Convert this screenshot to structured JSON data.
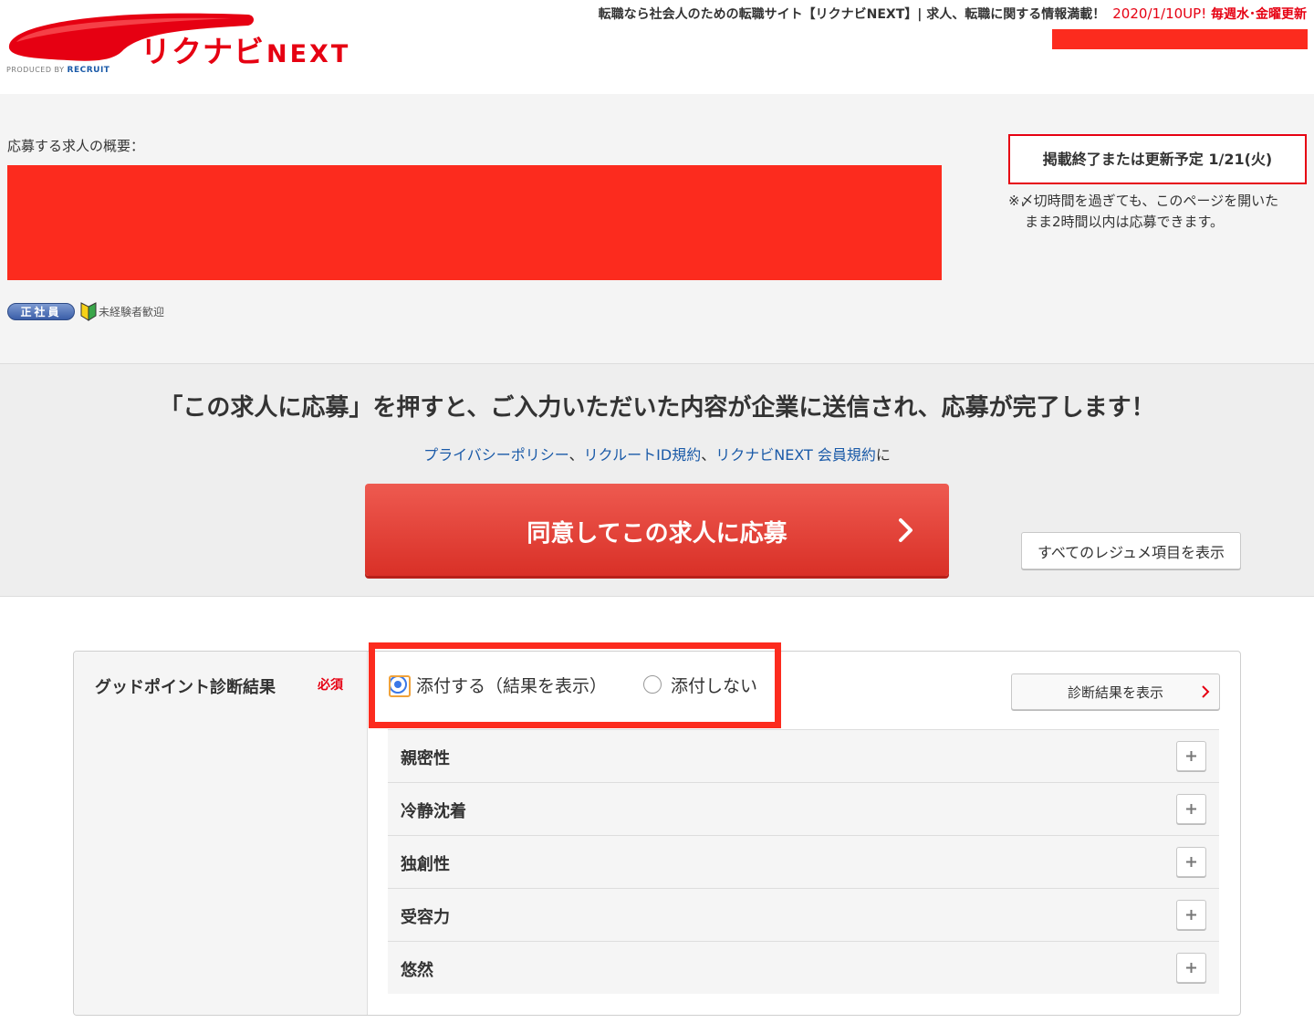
{
  "header": {
    "logo_kana": "リクナビ",
    "logo_next": "NEXT",
    "logo_produced_by": "PRODUCED BY",
    "logo_recruit": "RECRUIT",
    "tagline": "転職なら社会人のための転職サイト【リクナビNEXT】| 求人、転職に関する情報満載！",
    "update_date": "2020/1/10UP!",
    "update_schedule": "毎週水･金曜更新"
  },
  "summary": {
    "label": "応募する求人の概要：",
    "employment_badge": "正社員",
    "beginner_icon": "wakaba-mark-icon",
    "beginner_label": "未経験者歓迎",
    "deadline": "掲載終了または更新予定 1/21(火)",
    "deadline_note_line1": "※〆切時間を過ぎても、このページを開いた",
    "deadline_note_line2": "まま2時間以内は応募できます。"
  },
  "submit": {
    "message": "「この求人に応募」を押すと、ご入力いただいた内容が企業に送信され、応募が完了します！",
    "terms": {
      "privacy": "プライバシーポリシー",
      "sep1": "、",
      "recruit_id": "リクルートID規約",
      "sep2": "、",
      "member": "リクナビNEXT 会員規約",
      "suffix": "に"
    },
    "apply_button": "同意してこの求人に応募",
    "show_all_button": "すべてのレジュメ項目を表示"
  },
  "form": {
    "field_label": "グッドポイント診断結果",
    "required": "必須",
    "options": [
      {
        "label": "添付する（結果を表示）",
        "selected": true
      },
      {
        "label": "添付しない",
        "selected": false
      }
    ],
    "diagnosis_button": "診断結果を表示",
    "results": [
      "親密性",
      "冷静沈着",
      "独創性",
      "受容力",
      "悠然"
    ]
  },
  "colors": {
    "brand_red": "#e60012",
    "redaction": "#fc2b1e",
    "link_blue": "#1a5aa8",
    "radio_blue": "#3b78e7"
  }
}
